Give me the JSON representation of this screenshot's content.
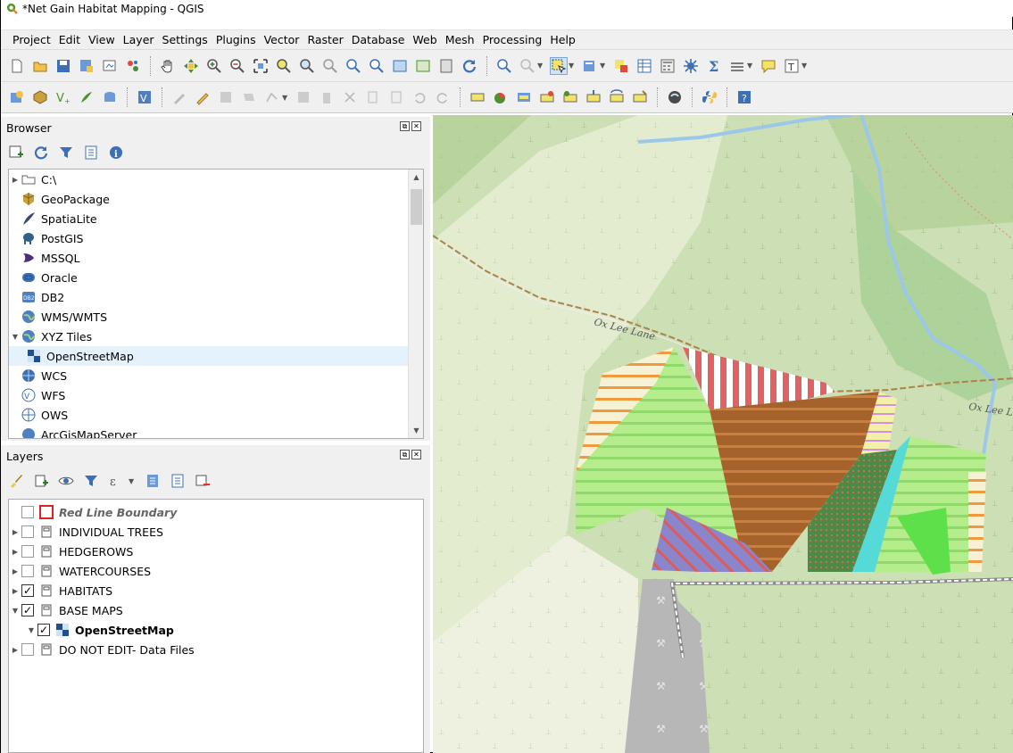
{
  "window": {
    "title": "*Net Gain Habitat Mapping - QGIS"
  },
  "menu": [
    "Project",
    "Edit",
    "View",
    "Layer",
    "Settings",
    "Plugins",
    "Vector",
    "Raster",
    "Database",
    "Web",
    "Mesh",
    "Processing",
    "Help"
  ],
  "browser": {
    "title": "Browser",
    "items": [
      {
        "label": "C:\\",
        "icon": "folder-icon"
      },
      {
        "label": "GeoPackage",
        "icon": "geopackage-icon"
      },
      {
        "label": "SpatiaLite",
        "icon": "spatialite-feather-icon"
      },
      {
        "label": "PostGIS",
        "icon": "postgis-elephant-icon"
      },
      {
        "label": "MSSQL",
        "icon": "mssql-icon"
      },
      {
        "label": "Oracle",
        "icon": "oracle-icon"
      },
      {
        "label": "DB2",
        "icon": "db2-icon"
      },
      {
        "label": "WMS/WMTS",
        "icon": "globe-icon"
      },
      {
        "label": "XYZ Tiles",
        "icon": "globe-icon"
      },
      {
        "label": "OpenStreetMap",
        "icon": "xyz-tile-icon"
      },
      {
        "label": "WCS",
        "icon": "globe-icon"
      },
      {
        "label": "WFS",
        "icon": "wfs-icon"
      },
      {
        "label": "OWS",
        "icon": "ows-icon"
      },
      {
        "label": "ArcGisMapServer",
        "icon": "globe-icon"
      }
    ]
  },
  "layers": {
    "title": "Layers",
    "items": [
      {
        "label": "Red Line Boundary",
        "checked": false,
        "type": "polygon"
      },
      {
        "label": "INDIVIDUAL TREES",
        "checked": false,
        "type": "group"
      },
      {
        "label": "HEDGEROWS",
        "checked": false,
        "type": "group"
      },
      {
        "label": "WATERCOURSES",
        "checked": false,
        "type": "group"
      },
      {
        "label": "HABITATS",
        "checked": true,
        "type": "group"
      },
      {
        "label": "BASE MAPS",
        "checked": true,
        "type": "group"
      },
      {
        "label": "OpenStreetMap",
        "checked": true,
        "type": "tile"
      },
      {
        "label": "DO NOT EDIT- Data Files",
        "checked": false,
        "type": "group"
      }
    ]
  },
  "map": {
    "road_labels": [
      "Ox Lee Lane",
      "Ox Lee L"
    ]
  }
}
